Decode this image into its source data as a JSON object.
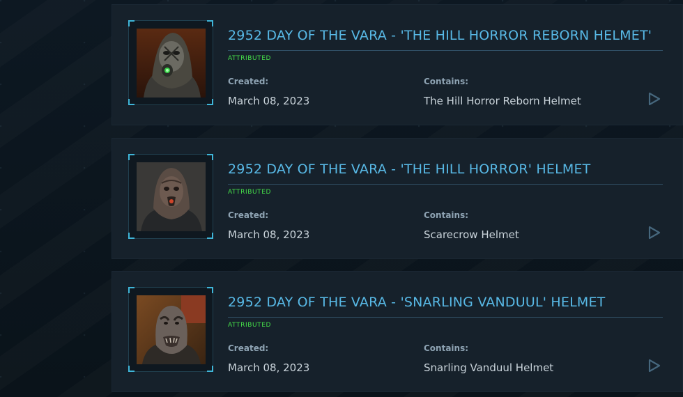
{
  "pledges": [
    {
      "title": "2952 DAY OF THE VARA - 'THE HILL HORROR REBORN HELMET'",
      "status": "ATTRIBUTED",
      "created_label": "Created:",
      "created_value": "March 08, 2023",
      "contains_label": "Contains:",
      "contains_value": "The Hill Horror Reborn Helmet"
    },
    {
      "title": "2952 DAY OF THE VARA - 'THE HILL HORROR' HELMET",
      "status": "ATTRIBUTED",
      "created_label": "Created:",
      "created_value": "March 08, 2023",
      "contains_label": "Contains:",
      "contains_value": "Scarecrow Helmet"
    },
    {
      "title": "2952 DAY OF THE VARA - 'SNARLING VANDUUL' HELMET",
      "status": "ATTRIBUTED",
      "created_label": "Created:",
      "created_value": "March 08, 2023",
      "contains_label": "Contains:",
      "contains_value": "Snarling Vanduul Helmet"
    }
  ],
  "colors": {
    "title": "#58b9e6",
    "status": "#46e14a",
    "frame_accent": "#3fb6d9",
    "play_icon": "#46677d"
  },
  "icons": {
    "expand": "play-triangle-icon"
  }
}
